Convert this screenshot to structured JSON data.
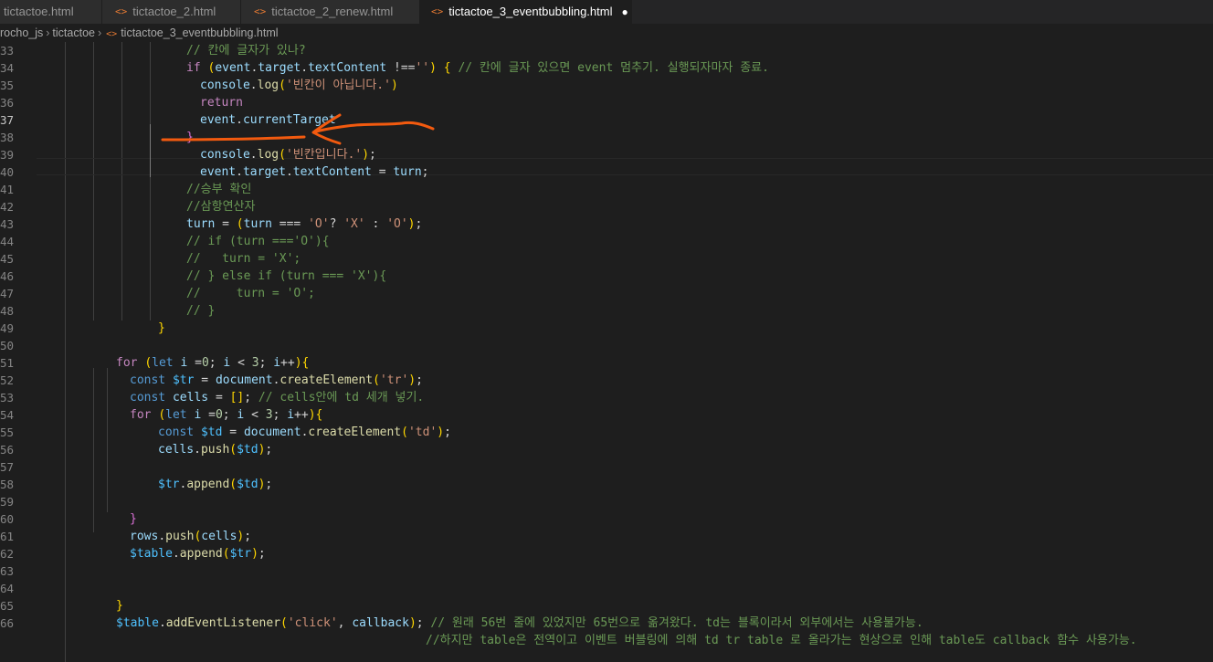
{
  "tabs": [
    {
      "label": "tictactoe.html",
      "icon": "html-file-icon",
      "active": false
    },
    {
      "label": "tictactoe_2.html",
      "icon": "html-file-icon",
      "active": false
    },
    {
      "label": "tictactoe_2_renew.html",
      "icon": "html-file-icon",
      "active": false
    },
    {
      "label": "tictactoe_3_eventbubbling.html",
      "icon": "html-file-icon",
      "active": true,
      "unsaved": true
    }
  ],
  "breadcrumb": [
    "rocho_js",
    "tictactoe",
    "tictactoe_3_eventbubbling.html"
  ],
  "editor": {
    "current_line": 37,
    "lines": [
      {
        "n": "33",
        "code": "// 칸에 글자가 있나?"
      },
      {
        "n": "34",
        "code": "if (event.target.textContent !=='') { // 칸에 글자 있으면 event 멈추기. 실행되자마자 종료."
      },
      {
        "n": "35",
        "code": "console.log('빈칸이 아닙니다.')"
      },
      {
        "n": "36",
        "code": "return"
      },
      {
        "n": "37",
        "code": "event.currentTarget"
      },
      {
        "n": "38",
        "code": "}"
      },
      {
        "n": "39",
        "code": "console.log('빈칸입니다.');"
      },
      {
        "n": "40",
        "code": "event.target.textContent = turn;"
      },
      {
        "n": "41",
        "code": "//승부 확인"
      },
      {
        "n": "42",
        "code": "//삼항연산자"
      },
      {
        "n": "43",
        "code": "turn = (turn === 'O'? 'X' : 'O');"
      },
      {
        "n": "44",
        "code": "// if (turn ==='O'){"
      },
      {
        "n": "45",
        "code": "//   turn = 'X';"
      },
      {
        "n": "46",
        "code": "// } else if (turn === 'X'){"
      },
      {
        "n": "47",
        "code": "//     turn = 'O';"
      },
      {
        "n": "48",
        "code": "// }"
      },
      {
        "n": "49",
        "code": "}"
      },
      {
        "n": "50",
        "code": ""
      },
      {
        "n": "51",
        "code": "for (let i =0; i < 3; i++){"
      },
      {
        "n": "52",
        "code": "const $tr = document.createElement('tr');"
      },
      {
        "n": "53",
        "code": "const cells = []; // cells안에 td 세개 넣기."
      },
      {
        "n": "54",
        "code": "for (let i =0; i < 3; i++){"
      },
      {
        "n": "55",
        "code": "const $td = document.createElement('td');"
      },
      {
        "n": "56",
        "code": "cells.push($td);"
      },
      {
        "n": "57",
        "code": ""
      },
      {
        "n": "58",
        "code": "$tr.append($td);"
      },
      {
        "n": "59",
        "code": ""
      },
      {
        "n": "60",
        "code": "}"
      },
      {
        "n": "61",
        "code": "rows.push(cells);"
      },
      {
        "n": "62",
        "code": "$table.append($tr);"
      },
      {
        "n": "63",
        "code": ""
      },
      {
        "n": "64",
        "code": ""
      },
      {
        "n": "65",
        "code": "}"
      },
      {
        "n": "66",
        "code": "$table.addEventListener('click', callback); // 원래 56번 줄에 있었지만 65번으로 옮겨왔다. td는 블록이라서 외부에서는 사용불가능."
      },
      {
        "n": "",
        "code": "//하지만 table은 전역이고 이벤트 버블링에 의해 td tr table 로 올라가는 현상으로 인해 table도 callback 함수 사용가능."
      }
    ]
  },
  "annotation": {
    "color": "#f25a0f",
    "shape": "hand-drawn arrow and underline pointing at line 37"
  }
}
